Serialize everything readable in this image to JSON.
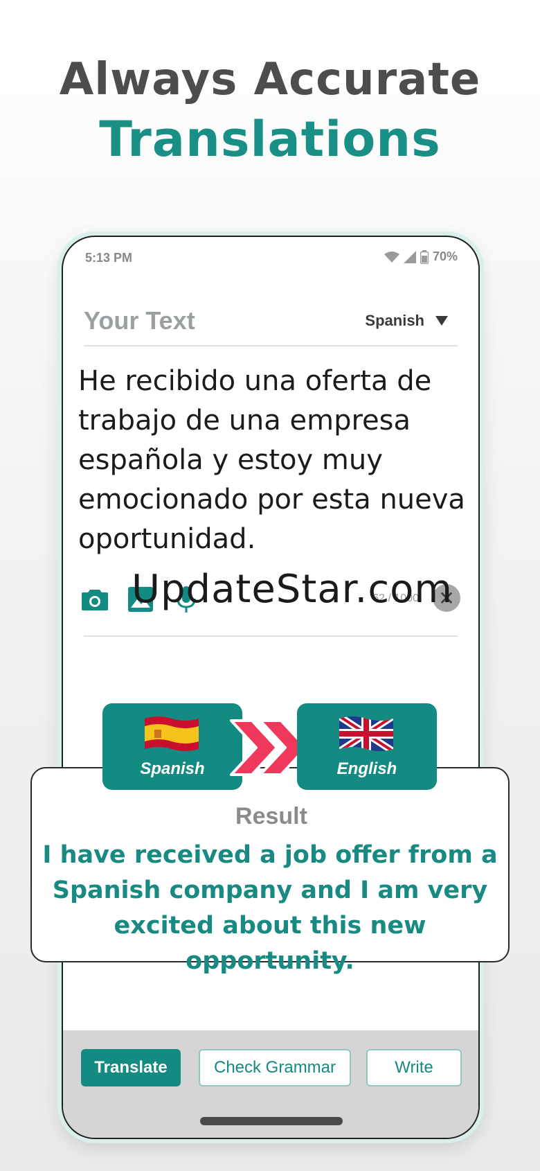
{
  "headline": {
    "line1": "Always Accurate",
    "line2": "Translations"
  },
  "status_bar": {
    "time": "5:13 PM",
    "battery": "70%"
  },
  "source": {
    "label": "Your Text",
    "language": "Spanish",
    "text": "He recibido una oferta de trabajo de una empresa española y estoy muy emocionado por esta nueva oportunidad.",
    "counter": "62 / 1000"
  },
  "watermark": "UpdateStar.com",
  "languages": {
    "from": "Spanish",
    "to": "English"
  },
  "result": {
    "label": "Result",
    "text": "I have received a job offer from a Spanish company and I am very excited about this new opportunity."
  },
  "actions": {
    "translate": "Translate",
    "check_grammar": "Check Grammar",
    "write": "Write"
  },
  "colors": {
    "accent": "#138a82",
    "arrow": "#f0385c",
    "headline_gray": "#4d4d4d"
  },
  "icons": [
    "camera-icon",
    "image-icon",
    "microphone-icon",
    "close-icon",
    "wifi-icon",
    "signal-icon",
    "battery-icon",
    "dropdown-arrow-icon",
    "double-chevron-icon",
    "spain-flag-icon",
    "uk-flag-icon"
  ]
}
